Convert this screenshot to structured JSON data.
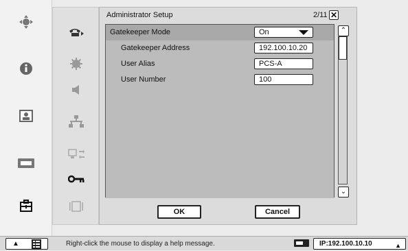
{
  "left_nav": {
    "items": [
      {
        "name": "nav-control-icon"
      },
      {
        "name": "info-icon"
      },
      {
        "name": "camera-view-icon"
      },
      {
        "name": "memory-card-icon"
      },
      {
        "name": "toolbox-icon"
      }
    ]
  },
  "categories": [
    {
      "name": "telephone-icon"
    },
    {
      "name": "gear-icon"
    },
    {
      "name": "speaker-icon"
    },
    {
      "name": "network-icon"
    },
    {
      "name": "monitor-transfer-icon"
    },
    {
      "name": "key-icon"
    },
    {
      "name": "display-frame-icon"
    }
  ],
  "panel": {
    "title": "Administrator Setup",
    "page": "2/11",
    "close_symbol": "✕",
    "rows": [
      {
        "label": "Gatekeeper Mode",
        "value": "On",
        "type": "dropdown"
      },
      {
        "label": "Gatekeeper Address",
        "value": "192.100.10.20",
        "type": "text"
      },
      {
        "label": "User Alias",
        "value": "PCS-A",
        "type": "text"
      },
      {
        "label": "User Number",
        "value": "100",
        "type": "text"
      }
    ],
    "scroll_up_symbol": "⌃",
    "scroll_down_symbol": "⌄",
    "ok_label": "OK",
    "cancel_label": "Cancel"
  },
  "statusbar": {
    "menu_arrow": "▲",
    "help_message": "Right-click the mouse to display a help message.",
    "ip": "IP:192.100.10.10",
    "ip_arrow": "▲"
  }
}
